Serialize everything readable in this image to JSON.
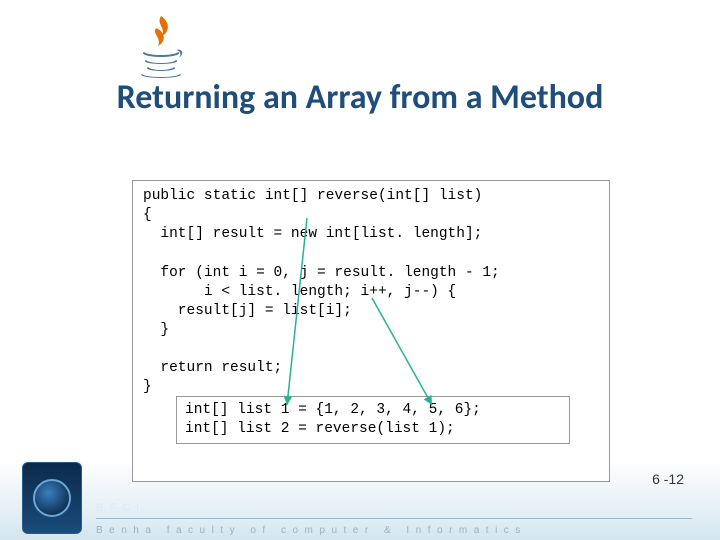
{
  "title": "Returning an Array from a Method",
  "code_main": "public static int[] reverse(int[] list)\n{\n  int[] result = new int[list. length];\n\n  for (int i = 0, j = result. length - 1;\n       i < list. length; i++, j--) {\n    result[j] = list[i];\n  }\n\n  return result;\n}",
  "code_sub": "int[] list 1 = {1, 2, 3, 4, 5, 6};\nint[] list 2 = reverse(list 1);",
  "page_number": "6 -12",
  "footer": {
    "acronym": "BFCI",
    "text": "Benha faculty of computer & Informatics"
  },
  "colors": {
    "title": "#1e4e79",
    "arrow": "#29b196"
  }
}
